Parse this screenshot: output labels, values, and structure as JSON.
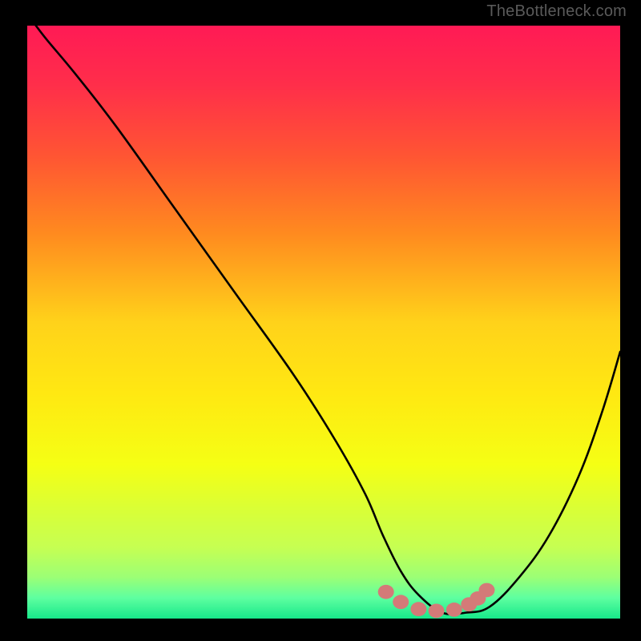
{
  "attribution": "TheBottleneck.com",
  "colors": {
    "background": "#000000",
    "gradient_stops": [
      {
        "offset": 0.0,
        "color": "#ff1a55"
      },
      {
        "offset": 0.1,
        "color": "#ff2e4a"
      },
      {
        "offset": 0.22,
        "color": "#ff5533"
      },
      {
        "offset": 0.35,
        "color": "#ff8a1f"
      },
      {
        "offset": 0.5,
        "color": "#ffd21a"
      },
      {
        "offset": 0.62,
        "color": "#ffe812"
      },
      {
        "offset": 0.74,
        "color": "#f5ff14"
      },
      {
        "offset": 0.82,
        "color": "#d8ff38"
      },
      {
        "offset": 0.88,
        "color": "#c6ff52"
      },
      {
        "offset": 0.93,
        "color": "#9cff75"
      },
      {
        "offset": 0.965,
        "color": "#5effa0"
      },
      {
        "offset": 1.0,
        "color": "#17e88a"
      }
    ],
    "curve": "#000000",
    "marker": "#d47a78",
    "attribution_text": "#5a5a5a"
  },
  "chart_data": {
    "type": "line",
    "title": "",
    "xlabel": "",
    "ylabel": "",
    "xlim": [
      0,
      100
    ],
    "ylim": [
      0,
      100
    ],
    "series": [
      {
        "name": "bottleneck-curve",
        "x": [
          0,
          3,
          8,
          15,
          25,
          35,
          45,
          52,
          57,
          60,
          63,
          66,
          70,
          74,
          78,
          83,
          88,
          93,
          97,
          100
        ],
        "y": [
          102,
          98,
          92,
          83,
          69,
          55,
          41,
          30,
          21,
          14,
          8,
          4,
          1,
          1,
          2,
          7,
          14,
          24,
          35,
          45
        ]
      }
    ],
    "markers": {
      "name": "optimal-range",
      "x": [
        60.5,
        63,
        66,
        69,
        72,
        74.5,
        76,
        77.5
      ],
      "y": [
        4.5,
        2.8,
        1.6,
        1.3,
        1.5,
        2.4,
        3.4,
        4.8
      ]
    }
  }
}
